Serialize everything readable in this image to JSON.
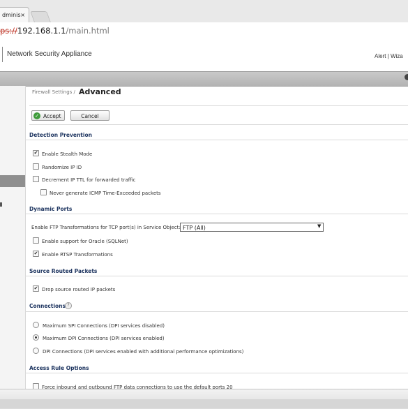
{
  "browser": {
    "tab_title": "dminis",
    "tab_close": "×",
    "url_scheme": "ps://",
    "url_host": "192.168.1.1",
    "url_path": "/main.html"
  },
  "header": {
    "app_title": "Network Security Appliance",
    "links": "Alert  |  Wiza"
  },
  "page": {
    "breadcrumb": "Firewall Settings /",
    "title": "Advanced"
  },
  "toolbar": {
    "accept_label": "Accept",
    "cancel_label": "Cancel",
    "accept_icon": "✓"
  },
  "sections": {
    "detection": {
      "title": "Detection Prevention",
      "stealth": "Enable Stealth Mode",
      "randomize": "Randomize IP ID",
      "decrement": "Decrement IP TTL for forwarded traffic",
      "never_generate": "Never generate ICMP Time-Exceeded packets"
    },
    "dynamic_ports": {
      "title": "Dynamic Ports",
      "ftp_label": "Enable FTP Transformations for TCP port(s) in Service Object:",
      "ftp_value": "FTP (All)",
      "oracle": "Enable support for Oracle (SQLNet)",
      "rtsp": "Enable RTSP Transformations"
    },
    "source_routed": {
      "title": "Source Routed Packets",
      "drop": "Drop source routed IP packets"
    },
    "connections": {
      "title": "Connections",
      "help": "?",
      "max_spi": "Maximum SPI Connections (DPI services disabled)",
      "max_dpi": "Maximum DPI Connections (DPI services enabled)",
      "dpi": "DPI Connections (DPI services enabled with additional performance optimizations)"
    },
    "access_rule": {
      "title": "Access Rule Options",
      "force": "Force inbound and outbound FTP data connections to use the default ports 20"
    }
  },
  "checks": {
    "on": "✔",
    "dropdown_arrow": "▼"
  },
  "colors": {
    "section_title": "#1e3560",
    "accept_green": "#3f9b3b",
    "nav_bar": "#b3b3b3"
  }
}
